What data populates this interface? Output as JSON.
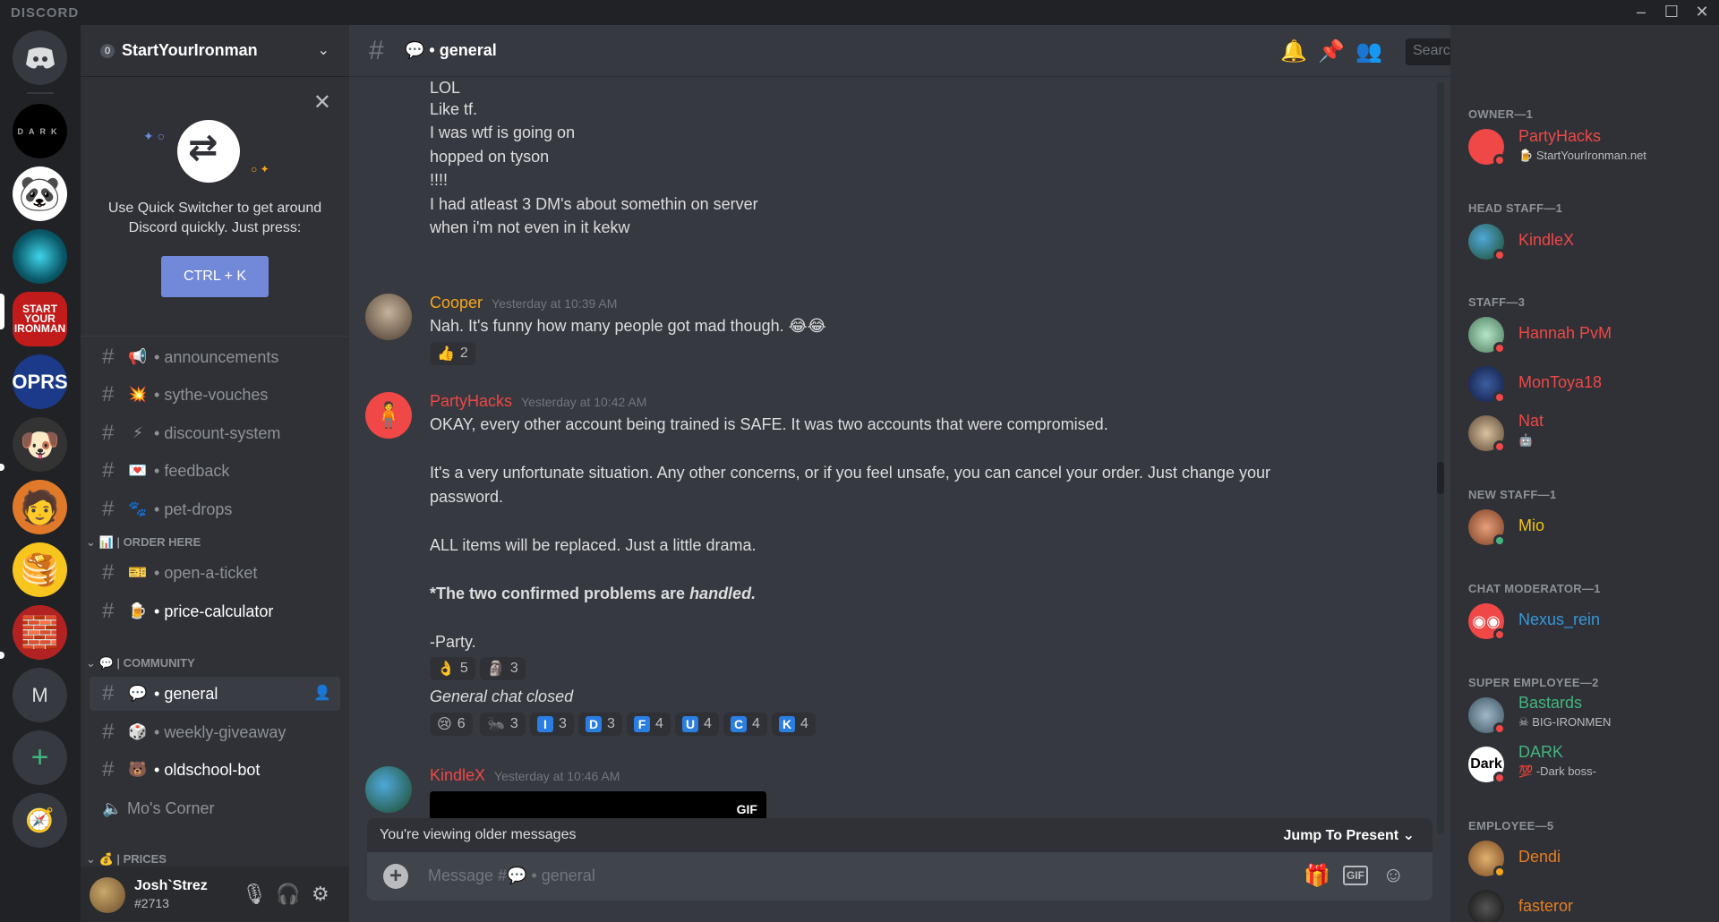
{
  "app": {
    "brand": "DISCORD"
  },
  "guild": {
    "name": "StartYourIronman",
    "badge": "0"
  },
  "quick_switcher": {
    "text": "Use Quick Switcher to get around Discord quickly. Just press:",
    "button": "CTRL + K"
  },
  "channels": [
    {
      "emoji": "📢",
      "name": "announcements"
    },
    {
      "emoji": "💥",
      "name": "sythe-vouches"
    },
    {
      "emoji": "⚡",
      "name": "discount-system"
    },
    {
      "emoji": "💌",
      "name": "feedback"
    },
    {
      "emoji": "🐾",
      "name": "pet-drops"
    }
  ],
  "categories": {
    "order": "📊 | ORDER HERE",
    "community": "💬 | COMMUNITY",
    "prices": "💰 | PRICES"
  },
  "order_channels": [
    {
      "emoji": "🎫",
      "name": "open-a-ticket"
    },
    {
      "emoji": "🍺",
      "name": "price-calculator"
    }
  ],
  "community_channels": [
    {
      "emoji": "💬",
      "name": "general"
    },
    {
      "emoji": "🎲",
      "name": "weekly-giveaway"
    },
    {
      "emoji": "🐻",
      "name": "oldschool-bot"
    },
    {
      "emoji": "🔊",
      "name": "Mo's Corner"
    }
  ],
  "user": {
    "name": "Josh`Strez",
    "tag": "#2713"
  },
  "header": {
    "channel": "💬 • general",
    "search_placeholder": "Search"
  },
  "messages": {
    "prev_lines": [
      "LOL",
      "Like tf.",
      "I was wtf is going on",
      "hopped on tyson",
      "!!!!",
      "I had atleast 3 DM's about somethin on server",
      "when i'm not even in it kekw"
    ],
    "cooper": {
      "author": "Cooper",
      "time": "Yesterday at 10:39 AM",
      "text": "Nah. It's funny how many people got mad though. 😂😂",
      "reaction": "👍",
      "count": "2"
    },
    "party": {
      "author": "PartyHacks",
      "time": "Yesterday at 10:42 AM",
      "l1": "OKAY, every other account being trained is SAFE. It was two accounts that were compromised.",
      "l2": "It's a very unfortunate situation. Any other concerns, or if you feel unsafe, you can cancel your order. Just change your",
      "l3": "password.",
      "l4": "ALL items will be replaced. Just a little drama.",
      "l5a": "*The two confirmed problems are ",
      "l5b": "handled.",
      "l6": "-Party.",
      "reactions1": [
        {
          "e": "👌",
          "c": "5"
        },
        {
          "e": "🗿",
          "c": "3"
        }
      ],
      "closed": "General chat closed",
      "reactions2": [
        {
          "e": "😢",
          "c": "6"
        },
        {
          "e": "🐜",
          "c": "3"
        },
        {
          "l": "I",
          "c": "3"
        },
        {
          "l": "D",
          "c": "3"
        },
        {
          "l": "F",
          "c": "4"
        },
        {
          "l": "U",
          "c": "4"
        },
        {
          "l": "C",
          "c": "4"
        },
        {
          "l": "K",
          "c": "4"
        }
      ]
    },
    "kindle": {
      "author": "KindleX",
      "time": "Yesterday at 10:46 AM",
      "gif": "GIF"
    }
  },
  "older_bar": {
    "text": "You're viewing older messages",
    "jump": "Jump To Present"
  },
  "composer": {
    "placeholder": "Message #💬 • general"
  },
  "members": {
    "owner": {
      "role": "OWNER—1",
      "name": "PartyHacks",
      "status": "StartYourIronman.net"
    },
    "head": {
      "role": "HEAD STAFF—1",
      "name": "KindleX"
    },
    "staff": {
      "role": "STAFF—3",
      "m1": "Hannah PvM",
      "m2": "MonToya18",
      "m3": "Nat"
    },
    "new": {
      "role": "NEW STAFF—1",
      "name": "Mio"
    },
    "mod": {
      "role": "CHAT MODERATOR—1",
      "name": "Nexus_rein"
    },
    "super": {
      "role": "SUPER EMPLOYEE—2",
      "m1": "Bastards",
      "m1s": "BIG-IRONMEN",
      "m2": "DARK",
      "m2s": "-Dark boss-"
    },
    "emp": {
      "role": "EMPLOYEE—5",
      "m1": "Dendi",
      "m2": "fasteror"
    }
  },
  "colors": {
    "red": "#f04747",
    "green": "#43b581",
    "orange": "#faa61a",
    "blue": "#00b0f4",
    "blurple": "#7289da"
  }
}
